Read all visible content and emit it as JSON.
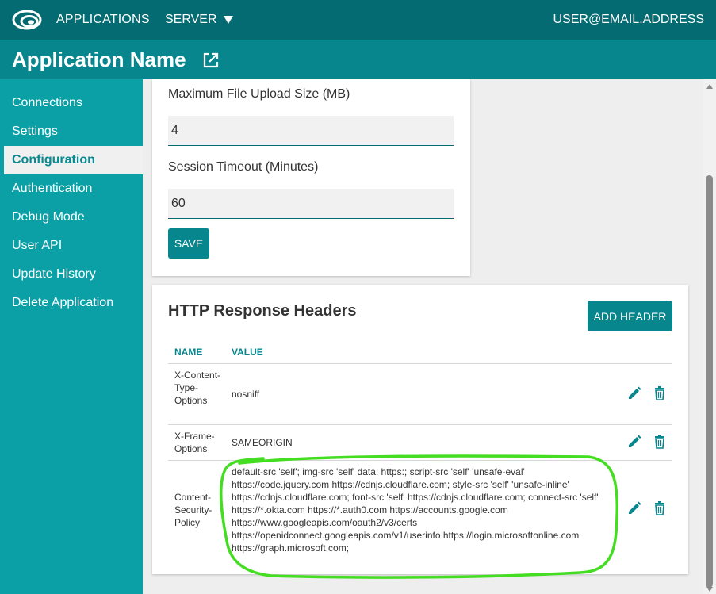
{
  "topbar": {
    "apps_label": "APPLICATIONS",
    "server_label": "SERVER",
    "user_label": "USER@EMAIL.ADDRESS"
  },
  "app": {
    "title": "Application Name"
  },
  "sidebar": {
    "items": [
      {
        "label": "Connections"
      },
      {
        "label": "Settings"
      },
      {
        "label": "Configuration"
      },
      {
        "label": "Authentication"
      },
      {
        "label": "Debug Mode"
      },
      {
        "label": "User API"
      },
      {
        "label": "Update History"
      },
      {
        "label": "Delete Application"
      }
    ],
    "active": "Configuration"
  },
  "config": {
    "upload_label": "Maximum File Upload Size (MB)",
    "upload_value": "4",
    "timeout_label": "Session Timeout (Minutes)",
    "timeout_value": "60",
    "save_label": "SAVE"
  },
  "headers": {
    "title": "HTTP Response Headers",
    "add_label": "ADD HEADER",
    "columns": [
      "NAME",
      "VALUE"
    ],
    "rows": [
      {
        "name": "X-Content-Type-Options",
        "value": "nosniff"
      },
      {
        "name": "X-Frame-Options",
        "value": "SAMEORIGIN"
      },
      {
        "name": "Content-Security-Policy",
        "value": "default-src 'self'; img-src 'self' data: https:; script-src 'self' 'unsafe-eval' https://code.jquery.com https://cdnjs.cloudflare.com; style-src 'self' 'unsafe-inline' https://cdnjs.cloudflare.com; font-src 'self' https://cdnjs.cloudflare.com; connect-src 'self' https://*.okta.com https://*.auth0.com https://accounts.google.com https://www.googleapis.com/oauth2/v3/certs https://openidconnect.googleapis.com/v1/userinfo https://login.microsoftonline.com https://graph.microsoft.com;"
      }
    ]
  },
  "icons": {
    "logo": "logo-icon",
    "external_link": "external-link-icon",
    "edit": "pencil-icon",
    "delete": "trash-icon"
  },
  "colors": {
    "topbar": "#056b72",
    "appbar": "#08868e",
    "sidebar": "#0aa0a6",
    "accent": "#08868e",
    "highlight": "#44dd22"
  }
}
